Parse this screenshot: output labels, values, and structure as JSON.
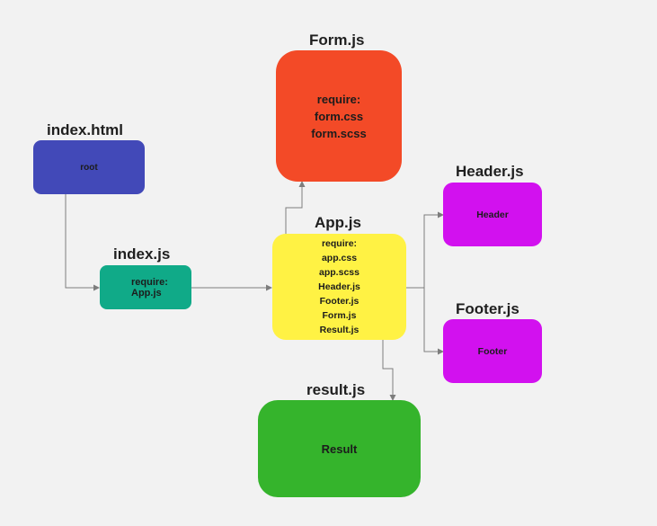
{
  "colors": {
    "background": "#f2f2f2",
    "index_html_box": "#4249b8",
    "index_js_box": "#10aa88",
    "form_js_box": "#f34a27",
    "app_js_box": "#fff244",
    "header_js_box": "#d211ef",
    "footer_js_box": "#d211ef",
    "result_js_box": "#35b42c",
    "connector": "#7d7d7d"
  },
  "nodes": {
    "index_html": {
      "title": "index.html",
      "lines": [
        "root"
      ]
    },
    "index_js": {
      "title": "index.js",
      "lines": [
        "require:",
        "App.js"
      ]
    },
    "form_js": {
      "title": "Form.js",
      "lines": [
        "require:",
        "form.css",
        "form.scss"
      ]
    },
    "app_js": {
      "title": "App.js",
      "lines": [
        "require:",
        "app.css",
        "app.scss",
        "Header.js",
        "Footer.js",
        "Form.js",
        "Result.js"
      ]
    },
    "header_js": {
      "title": "Header.js",
      "lines": [
        "Header"
      ]
    },
    "footer_js": {
      "title": "Footer.js",
      "lines": [
        "Footer"
      ]
    },
    "result_js": {
      "title": "result.js",
      "lines": [
        "Result"
      ]
    }
  }
}
